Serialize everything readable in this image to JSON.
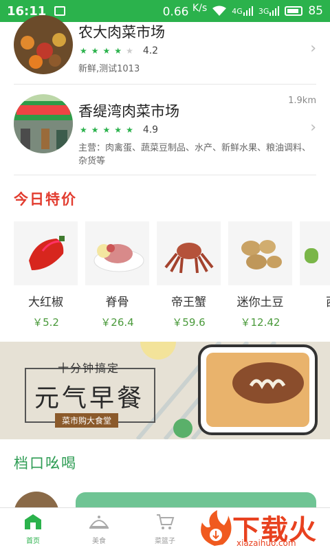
{
  "status": {
    "time": "16:11",
    "speed": "0.66",
    "speed_unit": "K/s",
    "battery": "85",
    "net1": "4G",
    "net2": "3G"
  },
  "markets": [
    {
      "name": "农大肉菜市场",
      "rating": "4.2",
      "stars": 4,
      "desc": "新鲜,测试1013",
      "distance": ""
    },
    {
      "name": "香缇湾肉菜市场",
      "rating": "4.9",
      "stars": 5,
      "desc": "主营：肉禽蛋、蔬菜豆制品、水产、新鲜水果、粮油调料、杂货等",
      "distance": "1.9km"
    }
  ],
  "today_special": {
    "title": "今日特价",
    "items": [
      {
        "name": "大红椒",
        "price": "￥5.2",
        "icon": "red-pepper"
      },
      {
        "name": "脊骨",
        "price": "￥26.4",
        "icon": "pork-spine"
      },
      {
        "name": "帝王蟹",
        "price": "￥59.6",
        "icon": "king-crab"
      },
      {
        "name": "迷你土豆",
        "price": "￥12.42",
        "icon": "mini-potato"
      },
      {
        "name": "西",
        "price": "",
        "icon": "zucchini"
      }
    ]
  },
  "banner": {
    "small": "十分钟搞定",
    "big": "元气早餐",
    "tag": "菜市购大食堂"
  },
  "stalls": {
    "title": "档口吆喝"
  },
  "bottom_nav": [
    {
      "label": "首页",
      "icon": "home-icon",
      "active": true
    },
    {
      "label": "美食",
      "icon": "food-cover-icon",
      "active": false
    },
    {
      "label": "菜篮子",
      "icon": "cart-icon",
      "active": false
    }
  ],
  "watermark": {
    "text": "下载火",
    "url": "xiazaihuo.com"
  },
  "colors": {
    "primary": "#2bb24c",
    "accent_red": "#e23c2f",
    "price": "#4a9a3b"
  }
}
